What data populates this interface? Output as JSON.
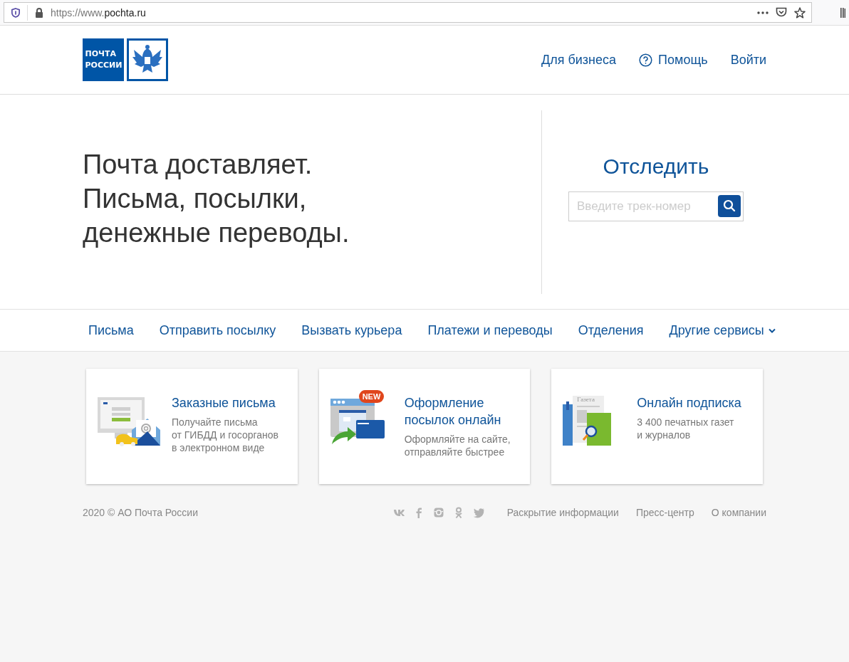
{
  "browser": {
    "url_prefix": "https://www.",
    "url_domain": "pochta.ru"
  },
  "header": {
    "logo_lines": [
      "ПОЧТА",
      "РОССИИ"
    ],
    "links": [
      {
        "label": "Для бизнеса",
        "kind": "plain"
      },
      {
        "label": "Помощь",
        "kind": "help"
      },
      {
        "label": "Войти",
        "kind": "plain"
      }
    ]
  },
  "hero": {
    "headline": [
      "Почта доставляет.",
      "Письма, посылки,",
      "денежные переводы."
    ],
    "track_title": "Отследить",
    "track_placeholder": "Введите трек-номер"
  },
  "nav": [
    {
      "label": "Письма",
      "dropdown": false
    },
    {
      "label": "Отправить посылку",
      "dropdown": false
    },
    {
      "label": "Вызвать курьера",
      "dropdown": false
    },
    {
      "label": "Платежи и переводы",
      "dropdown": false
    },
    {
      "label": "Отделения",
      "dropdown": false
    },
    {
      "label": "Другие сервисы",
      "dropdown": true
    }
  ],
  "cards": [
    {
      "kind": "letters",
      "title": [
        "Заказные письма"
      ],
      "text": [
        "Получайте письма",
        "от ГИБДД и госорганов",
        "в электронном виде"
      ]
    },
    {
      "kind": "parcels",
      "badge": "NEW",
      "title": [
        "Оформление",
        "посылок онлайн"
      ],
      "text": [
        "Оформляйте на сайте,",
        "отправляйте быстрее"
      ]
    },
    {
      "kind": "subscription",
      "paper_label": "Газета",
      "title": [
        "Онлайн подписка"
      ],
      "text": [
        "3 400 печатных газет",
        "и журналов"
      ]
    }
  ],
  "footer": {
    "copyright": "2020 © АО Почта России",
    "social": [
      {
        "kind": "vk"
      },
      {
        "kind": "facebook"
      },
      {
        "kind": "instagram"
      },
      {
        "kind": "ok"
      },
      {
        "kind": "twitter"
      }
    ],
    "links": [
      "Раскрытие информации",
      "Пресс-центр",
      "О компании"
    ]
  }
}
